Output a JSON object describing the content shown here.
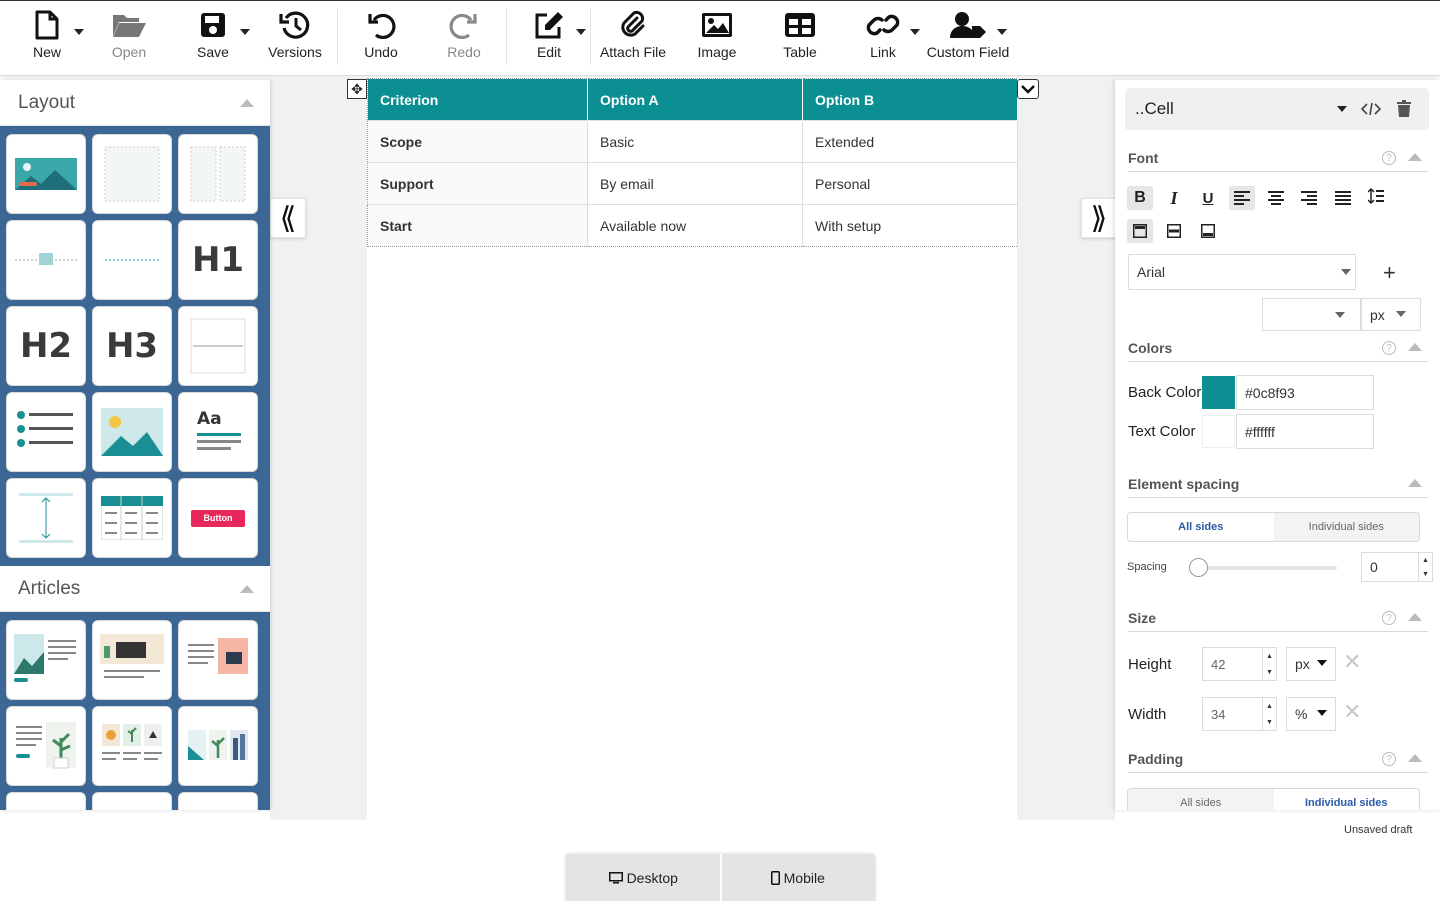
{
  "toolbar": {
    "new": "New",
    "open": "Open",
    "save": "Save",
    "versions": "Versions",
    "undo": "Undo",
    "redo": "Redo",
    "edit": "Edit",
    "attach": "Attach File",
    "image": "Image",
    "table": "Table",
    "link": "Link",
    "custom": "Custom Field"
  },
  "left_panel": {
    "layout_title": "Layout",
    "articles_title": "Articles",
    "h1": "H1",
    "h2": "H2",
    "h3": "H3",
    "aa": "Aa",
    "button": "Button"
  },
  "table": {
    "headers": [
      "Criterion",
      "Option A",
      "Option B"
    ],
    "rows": [
      [
        "Scope",
        "Basic",
        "Extended"
      ],
      [
        "Support",
        "By email",
        "Personal"
      ],
      [
        "Start",
        "Available now",
        "With setup"
      ]
    ]
  },
  "right_panel": {
    "selector": "..Cell",
    "font_title": "Font",
    "font_family": "Arial",
    "font_size": "",
    "font_unit": "px",
    "colors_title": "Colors",
    "back_color_label": "Back Color",
    "back_color_value": "#0c8f93",
    "text_color_label": "Text Color",
    "text_color_value": "#ffffff",
    "spacing_title": "Element spacing",
    "all_sides": "All sides",
    "individual_sides": "Individual sides",
    "spacing_label": "Spacing",
    "spacing_value": "0",
    "size_title": "Size",
    "height_label": "Height",
    "height_value": "42",
    "height_unit": "px",
    "width_label": "Width",
    "width_value": "34",
    "width_unit": "%",
    "padding_title": "Padding"
  },
  "status": "Unsaved draft",
  "device_tabs": {
    "desktop": "Desktop",
    "mobile": "Mobile"
  },
  "colors": {
    "accent": "#0c8f93",
    "panel_blue": "#3c6794"
  }
}
